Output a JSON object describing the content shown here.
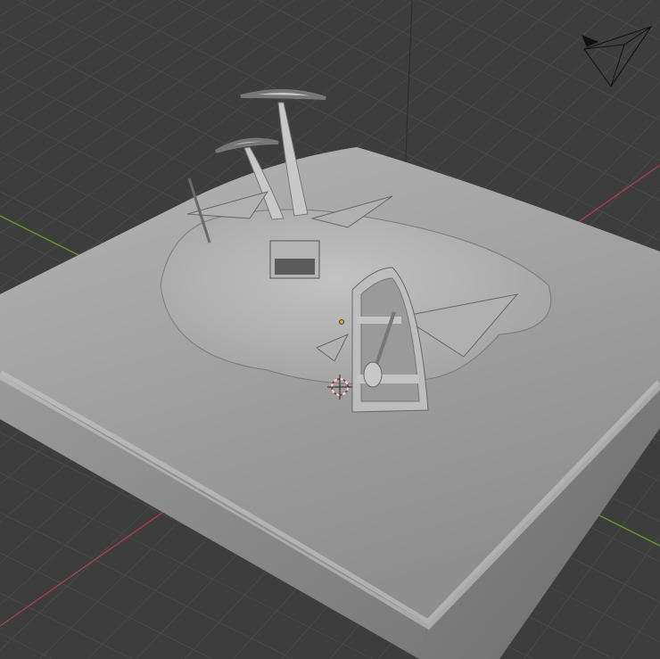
{
  "viewport": {
    "background": "#3d3d3d",
    "grid_color": "#4a4a4a",
    "x_axis_color": "#a8414b",
    "y_axis_color": "#6a9a2e",
    "model_color": "#a9a9a9"
  },
  "icons": {
    "camera": "camera-wireframe-icon",
    "cursor": "3d-cursor-icon",
    "origin": "object-origin-icon"
  }
}
